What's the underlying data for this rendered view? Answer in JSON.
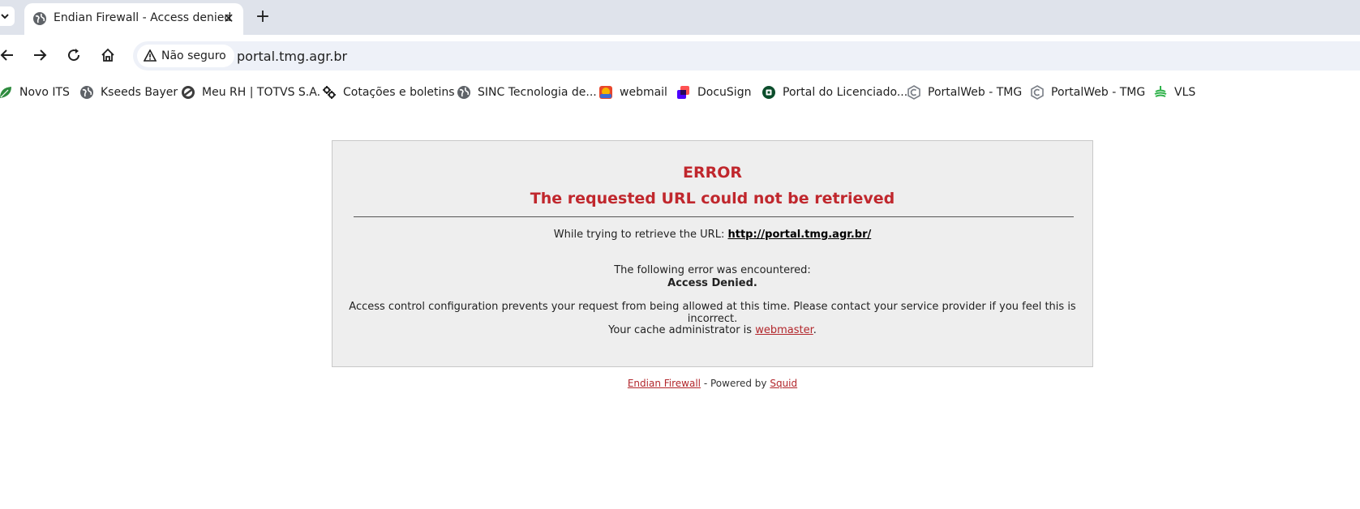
{
  "browser": {
    "tab": {
      "title": "Endian Firewall - Access denied",
      "close_symbol": "✕",
      "favicon": "globe-icon"
    },
    "new_tab_symbol": "+",
    "toolbar": {
      "security_label": "Não seguro",
      "url": "portal.tmg.agr.br"
    },
    "bookmarks": [
      {
        "label": "Novo ITS",
        "icon": "green-leaf-icon"
      },
      {
        "label": "Kseeds Bayer",
        "icon": "globe-icon"
      },
      {
        "label": "Meu RH | TOTVS S.A.",
        "icon": "totvs-icon"
      },
      {
        "label": "Cotações e boletins",
        "icon": "gear-cluster-icon"
      },
      {
        "label": "SINC Tecnologia de...",
        "icon": "globe-icon"
      },
      {
        "label": "webmail",
        "icon": "webmail-icon"
      },
      {
        "label": "DocuSign",
        "icon": "docusign-icon"
      },
      {
        "label": "Portal do Licenciado...",
        "icon": "green-square-icon"
      },
      {
        "label": "PortalWeb - TMG",
        "icon": "portalweb-icon"
      },
      {
        "label": "PortalWeb - TMG",
        "icon": "portalweb-icon"
      },
      {
        "label": "VLS",
        "icon": "vls-icon"
      }
    ]
  },
  "page": {
    "error_heading": "ERROR",
    "error_subheading": "The requested URL could not be retrieved",
    "retrieve_prefix": "While trying to retrieve the URL: ",
    "retrieve_url": "http://portal.tmg.agr.br/",
    "encountered_text": "The following error was encountered:",
    "error_name": "Access Denied.",
    "description": "Access control configuration prevents your request from being allowed at this time. Please contact your service provider if you feel this is incorrect.",
    "admin_prefix": "Your cache administrator is ",
    "admin_link": "webmaster",
    "admin_suffix": ".",
    "footer_link1": "Endian Firewall",
    "footer_middle": " - Powered by ",
    "footer_link2": "Squid"
  },
  "colors": {
    "error_red": "#c0272d",
    "link_red": "#b2262b",
    "box_bg": "#eeeeee",
    "tabstrip_bg": "#dfe3eb"
  }
}
